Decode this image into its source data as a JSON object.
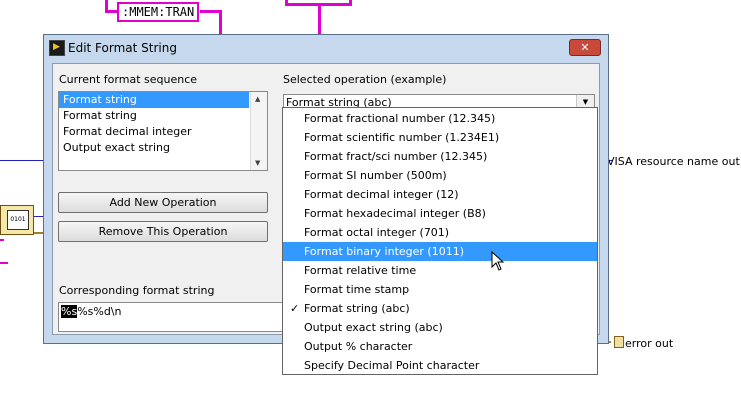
{
  "background": {
    "constant_text": ":MMEM:TRAN",
    "visa_label": "VISA resource name out",
    "error_label": "error out",
    "icon_text": "0101"
  },
  "dialog": {
    "title": "Edit Format String",
    "close_glyph": "✕",
    "current_sequence_label": "Current format sequence",
    "sequence_items": [
      "Format string",
      "Format string",
      "Format decimal integer",
      "Output exact string"
    ],
    "selected_sequence_index": 0,
    "add_button": "Add New Operation",
    "remove_button": "Remove This Operation",
    "corresponding_label": "Corresponding format string",
    "format_string_highlight": "%s",
    "format_string_rest": "%s%d\\n",
    "selected_operation_label": "Selected operation (example)",
    "selected_operation_value": "Format string (abc)"
  },
  "dropdown": {
    "items": [
      "Format fractional number (12.345)",
      "Format scientific number (1.234E1)",
      "Format fract/sci number (12.345)",
      "Format SI number (500m)",
      "Format decimal integer (12)",
      "Format hexadecimal integer (B8)",
      "Format octal integer (701)",
      "Format binary integer (1011)",
      "Format relative time",
      "Format time stamp",
      "Format string (abc)",
      "Output exact string (abc)",
      "Output % character",
      "Specify Decimal Point character"
    ],
    "highlighted_index": 7,
    "checked_index": 10,
    "check_glyph": "✓"
  },
  "colors": {
    "highlight": "#3399ff",
    "string_wire": "#e000d0",
    "ref_wire": "#2020c0",
    "title_bg": "#c6d8ee",
    "close_button": "#c84a3a"
  }
}
